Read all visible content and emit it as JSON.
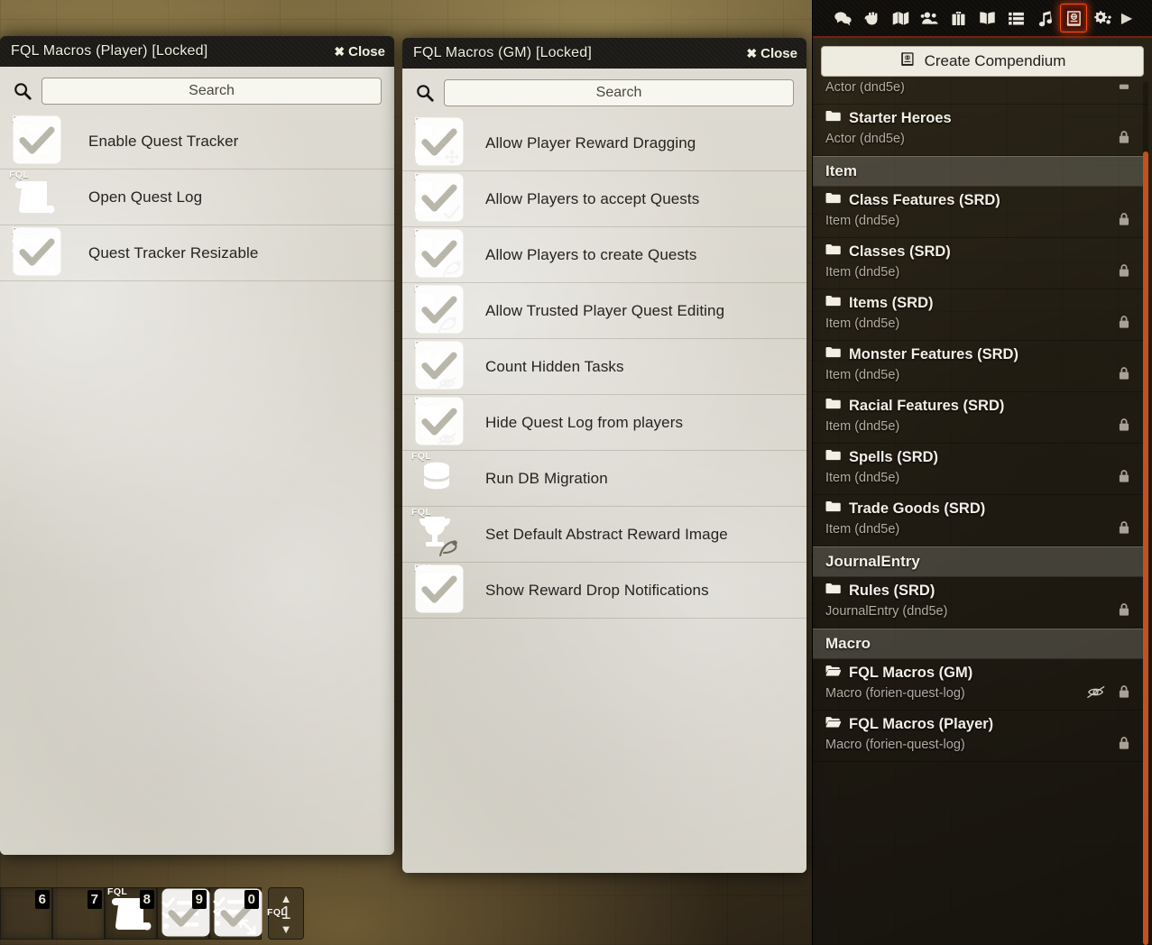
{
  "colors": {
    "accent_orange": "#ff4a17",
    "scrollbar": "#c4501d",
    "tab_border": "#7a1f10",
    "panel_bg": "#d7d4ca",
    "header_bg": "#1c1a16"
  },
  "player_window": {
    "title": "FQL Macros (Player) [Locked]",
    "close_label": "Close",
    "search_placeholder": "Search",
    "macros": [
      {
        "name": "Enable Quest Tracker",
        "icon": "checklist-icon",
        "badge": "FQL",
        "checkbox": true
      },
      {
        "name": "Open Quest Log",
        "icon": "scroll-icon",
        "badge": "FQL",
        "checkbox": false
      },
      {
        "name": "Quest Tracker Resizable",
        "icon": "checklist-resize-icon",
        "badge": "FQL",
        "checkbox": true
      }
    ]
  },
  "gm_window": {
    "title": "FQL Macros (GM) [Locked]",
    "close_label": "Close",
    "search_placeholder": "Search",
    "macros": [
      {
        "name": "Allow Player Reward Dragging",
        "icon": "users-move-icon",
        "badge": "FQL",
        "checkbox": true
      },
      {
        "name": "Allow Players to accept Quests",
        "icon": "users-check-icon",
        "badge": "FQL",
        "checkbox": true
      },
      {
        "name": "Allow Players to create Quests",
        "icon": "users-pen-icon",
        "badge": "FQL",
        "checkbox": true
      },
      {
        "name": "Allow Trusted Player Quest Editing",
        "icon": "user-star-pen-icon",
        "badge": "FQL",
        "checkbox": true
      },
      {
        "name": "Count Hidden Tasks",
        "icon": "hash-eye-slash-icon",
        "badge": "FQL",
        "checkbox": true
      },
      {
        "name": "Hide Quest Log from players",
        "icon": "scroll-eye-slash-icon",
        "badge": "FQL",
        "checkbox": true
      },
      {
        "name": "Run DB Migration",
        "icon": "database-icon",
        "badge": "FQL",
        "checkbox": false
      },
      {
        "name": "Set Default Abstract Reward Image",
        "icon": "trophy-pen-icon",
        "badge": "FQL",
        "checkbox": false
      },
      {
        "name": "Show Reward Drop Notifications",
        "icon": "trophy-exclamation-icon",
        "badge": "FQL",
        "checkbox": true
      }
    ]
  },
  "sidebar": {
    "tabs": [
      {
        "name": "chat-icon",
        "title": "Chat Messages",
        "active": false
      },
      {
        "name": "combat-icon",
        "title": "Combat Encounters",
        "active": false
      },
      {
        "name": "scenes-icon",
        "title": "Scenes",
        "active": false
      },
      {
        "name": "actors-icon",
        "title": "Actors",
        "active": false
      },
      {
        "name": "items-icon",
        "title": "Items",
        "active": false
      },
      {
        "name": "journal-icon",
        "title": "Journal Entries",
        "active": false
      },
      {
        "name": "tables-icon",
        "title": "Rollable Tables",
        "active": false
      },
      {
        "name": "playlists-icon",
        "title": "Playlists",
        "active": false
      },
      {
        "name": "compendium-icon",
        "title": "Compendium Packs",
        "active": true
      },
      {
        "name": "settings-icon",
        "title": "Settings",
        "active": false
      }
    ],
    "collapse_arrow": "collapse-sidebar-icon",
    "create_button": {
      "label": "Create Compendium",
      "icon": "compendium-icon"
    },
    "partial_entry": {
      "meta": "Actor (dnd5e)",
      "icons": [
        "lock-icon"
      ]
    },
    "groups": [
      {
        "header": "",
        "entries": [
          {
            "title": "Starter Heroes",
            "meta": "Actor (dnd5e)",
            "icon": "folder-icon",
            "icons": [
              "lock-icon"
            ]
          }
        ]
      },
      {
        "header": "Item",
        "entries": [
          {
            "title": "Class Features (SRD)",
            "meta": "Item (dnd5e)",
            "icon": "folder-icon",
            "icons": [
              "lock-icon"
            ]
          },
          {
            "title": "Classes (SRD)",
            "meta": "Item (dnd5e)",
            "icon": "folder-icon",
            "icons": [
              "lock-icon"
            ]
          },
          {
            "title": "Items (SRD)",
            "meta": "Item (dnd5e)",
            "icon": "folder-icon",
            "icons": [
              "lock-icon"
            ]
          },
          {
            "title": "Monster Features (SRD)",
            "meta": "Item (dnd5e)",
            "icon": "folder-icon",
            "icons": [
              "lock-icon"
            ]
          },
          {
            "title": "Racial Features (SRD)",
            "meta": "Item (dnd5e)",
            "icon": "folder-icon",
            "icons": [
              "lock-icon"
            ]
          },
          {
            "title": "Spells (SRD)",
            "meta": "Item (dnd5e)",
            "icon": "folder-icon",
            "icons": [
              "lock-icon"
            ]
          },
          {
            "title": "Trade Goods (SRD)",
            "meta": "Item (dnd5e)",
            "icon": "folder-icon",
            "icons": [
              "lock-icon"
            ]
          }
        ]
      },
      {
        "header": "JournalEntry",
        "entries": [
          {
            "title": "Rules (SRD)",
            "meta": "JournalEntry (dnd5e)",
            "icon": "folder-icon",
            "icons": [
              "lock-icon"
            ]
          }
        ]
      },
      {
        "header": "Macro",
        "entries": [
          {
            "title": "FQL Macros (GM)",
            "meta": "Macro (forien-quest-log)",
            "icon": "folder-open-icon",
            "icons": [
              "eye-slash-icon",
              "lock-icon"
            ]
          },
          {
            "title": "FQL Macros (Player)",
            "meta": "Macro (forien-quest-log)",
            "icon": "folder-open-icon",
            "icons": [
              "lock-icon"
            ]
          }
        ]
      }
    ]
  },
  "hotbar": {
    "slots": [
      {
        "key": "6",
        "icon": "",
        "badge": "",
        "checkbox": false
      },
      {
        "key": "7",
        "icon": "",
        "badge": "",
        "checkbox": false
      },
      {
        "key": "8",
        "icon": "scroll-icon",
        "badge": "FQL",
        "checkbox": false
      },
      {
        "key": "9",
        "icon": "checklist-icon",
        "badge": "FQL",
        "checkbox": true
      },
      {
        "key": "0",
        "icon": "checklist-resize-icon",
        "badge": "FQL",
        "checkbox": true
      }
    ],
    "page": "1",
    "page_up": "chevron-up-icon",
    "page_down": "chevron-down-icon"
  }
}
